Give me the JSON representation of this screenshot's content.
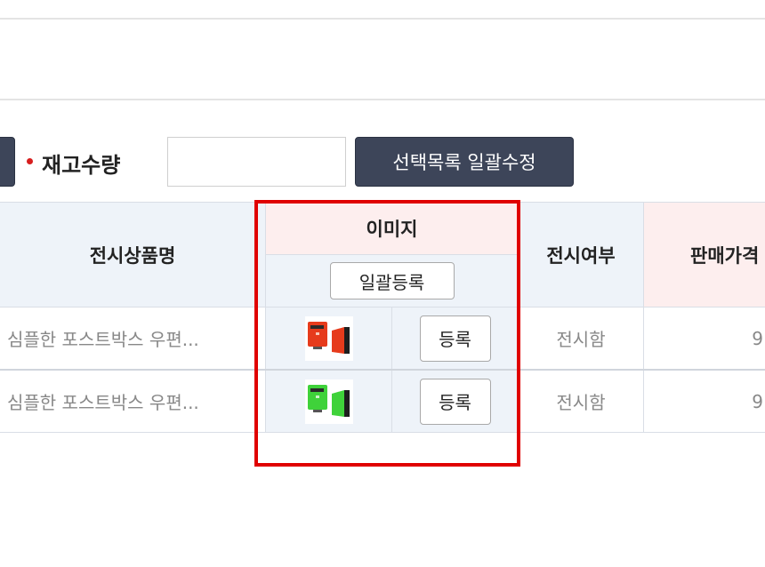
{
  "toolbar": {
    "stock_label": "재고수량",
    "stock_value": "",
    "batch_edit_label": "선택목록 일괄수정"
  },
  "table": {
    "headers": {
      "product_name": "전시상품명",
      "image": "이미지",
      "image_batch_button": "일괄등록",
      "display_status": "전시여부",
      "sale_price": "판매가격"
    },
    "rows": [
      {
        "product_name": "심플한 포스트박스 우편...",
        "thumbnail_icon": "red-postbox-thumbnail",
        "register_label": "등록",
        "display_status": "전시함",
        "sale_price": "9"
      },
      {
        "product_name": "심플한 포스트박스 우편...",
        "thumbnail_icon": "green-postbox-thumbnail",
        "register_label": "등록",
        "display_status": "전시함",
        "sale_price": "9"
      }
    ]
  },
  "colors": {
    "highlight_border": "#e00000",
    "dark_button": "#3d4559",
    "header_pink": "#fdeeee",
    "header_blue": "#eef3f9",
    "required_bullet": "#d71e1e",
    "red_thumbnail": "#e63b1c",
    "green_thumbnail": "#3fd23a"
  }
}
